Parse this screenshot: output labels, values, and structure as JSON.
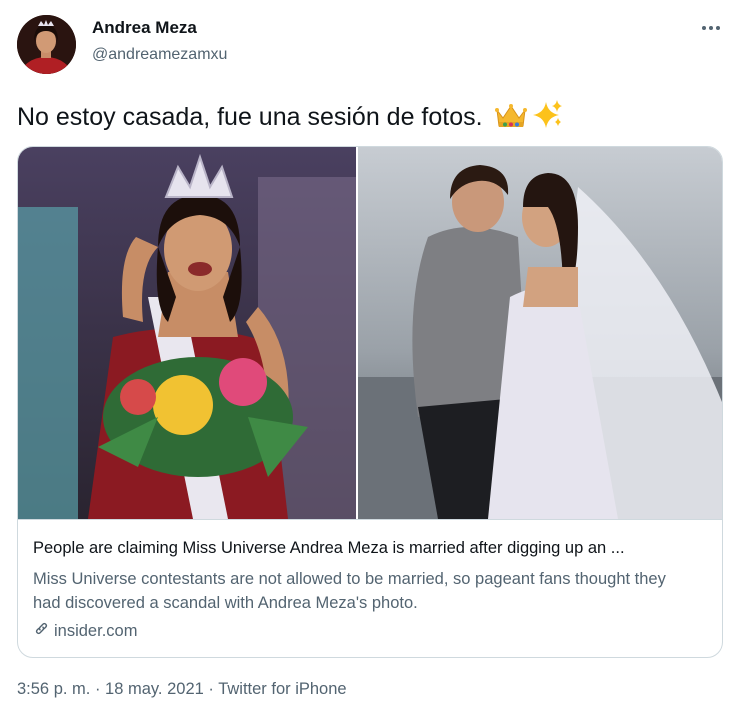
{
  "author": {
    "name": "Andrea Meza",
    "handle": "@andreamezamxu",
    "avatar_icon": "profile-photo"
  },
  "more_icon": "more-horizontal-icon",
  "tweet": {
    "text": "No estoy casada, fue una sesión de fotos. ",
    "emojis": [
      "crown-emoji",
      "sparkles-emoji"
    ]
  },
  "card": {
    "image_description_icon": "photo-collage",
    "title": "People are claiming Miss Universe Andrea Meza is married after digging up an ...",
    "description": "Miss Universe contestants are not allowed to be married, so pageant fans thought they had discovered a scandal with Andrea Meza's photo.",
    "domain": "insider.com",
    "domain_icon": "link-icon"
  },
  "meta": {
    "time": "3:56 p. m.",
    "separator1": " · ",
    "date": "18 may. 2021",
    "separator2": " · ",
    "source": "Twitter for iPhone"
  },
  "colors": {
    "text_primary": "#0f1419",
    "text_secondary": "#536471",
    "border": "#cfd9de"
  }
}
